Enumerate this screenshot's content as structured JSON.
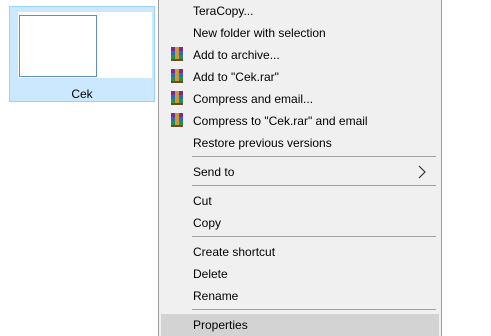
{
  "file": {
    "name": "Cek"
  },
  "menu": {
    "items": [
      {
        "label": "TeraCopy..."
      },
      {
        "label": "New folder with selection"
      },
      {
        "label": "Add to archive...",
        "icon": "winrar-icon"
      },
      {
        "label": "Add to \"Cek.rar\"",
        "icon": "winrar-icon"
      },
      {
        "label": "Compress and email...",
        "icon": "winrar-icon"
      },
      {
        "label": "Compress to \"Cek.rar\" and email",
        "icon": "winrar-icon"
      },
      {
        "label": "Restore previous versions"
      },
      {
        "label": "Send to",
        "icon": "chevron-right-icon"
      },
      {
        "label": "Cut"
      },
      {
        "label": "Copy"
      },
      {
        "label": "Create shortcut"
      },
      {
        "label": "Delete"
      },
      {
        "label": "Rename"
      },
      {
        "label": "Properties"
      }
    ]
  },
  "colors": {
    "selection_bg": "#cce8ff",
    "menu_bg": "#f0f0f0",
    "hover_bg": "#d3d3d3"
  }
}
